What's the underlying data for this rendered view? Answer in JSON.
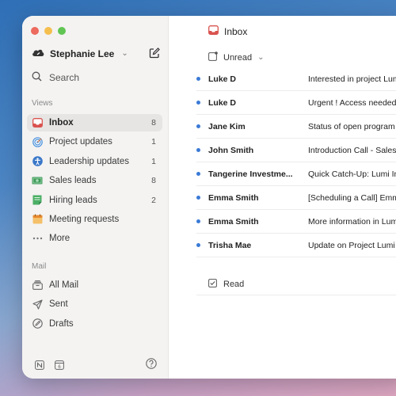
{
  "account": {
    "name": "Stephanie Lee"
  },
  "search": {
    "label": "Search"
  },
  "views": {
    "heading": "Views",
    "items": [
      {
        "label": "Inbox",
        "count": "8",
        "icon": "inbox-icon",
        "active": true
      },
      {
        "label": "Project updates",
        "count": "1",
        "icon": "target-icon"
      },
      {
        "label": "Leadership updates",
        "count": "1",
        "icon": "person-icon"
      },
      {
        "label": "Sales leads",
        "count": "8",
        "icon": "money-icon"
      },
      {
        "label": "Hiring leads",
        "count": "2",
        "icon": "note-icon"
      },
      {
        "label": "Meeting requests",
        "count": "",
        "icon": "calendar-icon"
      },
      {
        "label": "More",
        "count": "",
        "icon": "more-icon"
      }
    ]
  },
  "mail": {
    "heading": "Mail",
    "items": [
      {
        "label": "All Mail",
        "icon": "archive-icon"
      },
      {
        "label": "Sent",
        "icon": "send-icon"
      },
      {
        "label": "Drafts",
        "icon": "draft-icon"
      }
    ]
  },
  "main": {
    "title": "Inbox",
    "unread_label": "Unread",
    "read_label": "Read",
    "messages": [
      {
        "sender": "Luke D",
        "subject": "Interested in project Lumi"
      },
      {
        "sender": "Luke D",
        "subject": "Urgent ! Access needed"
      },
      {
        "sender": "Jane Kim",
        "subject": "Status of open program"
      },
      {
        "sender": "John Smith",
        "subject": "Introduction Call - Sales"
      },
      {
        "sender": "Tangerine Investme...",
        "subject": "Quick Catch-Up: Lumi In"
      },
      {
        "sender": "Emma Smith",
        "subject": "[Scheduling a Call] Emm"
      },
      {
        "sender": "Emma Smith",
        "subject": "More information in Lum"
      },
      {
        "sender": "Trisha Mae",
        "subject": "Update on Project Lumi"
      }
    ]
  },
  "colors": {
    "accent": "#3a7ad6",
    "inbox_red": "#d9534f"
  }
}
